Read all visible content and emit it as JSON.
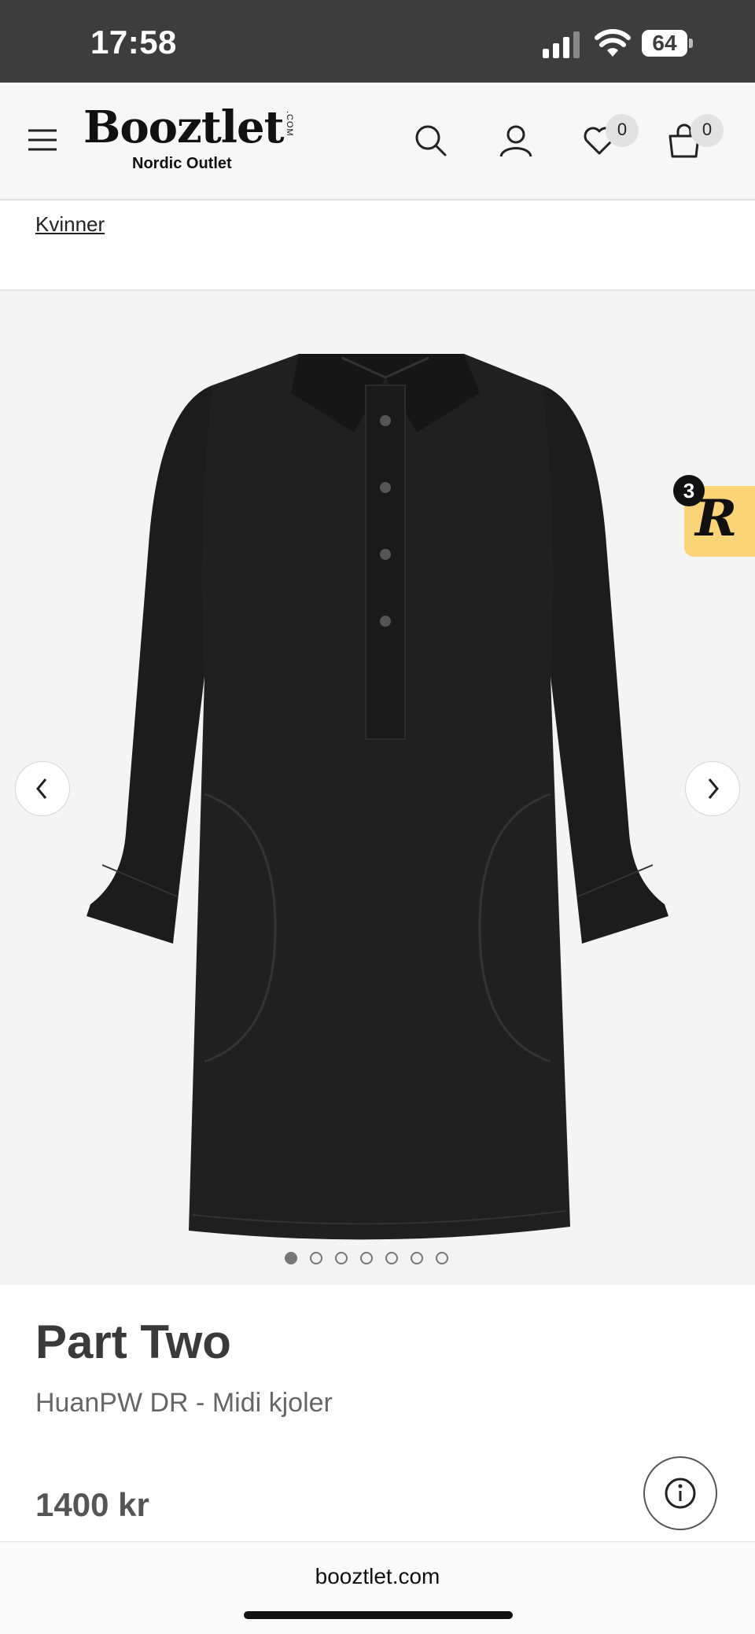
{
  "status_bar": {
    "time": "17:58",
    "battery": "64",
    "icons": [
      "signal-icon",
      "wifi-icon",
      "battery-icon"
    ]
  },
  "header": {
    "logo": "Booztlet",
    "logo_com": ".COM",
    "logo_sub": "Nordic Outlet",
    "wishlist_count": "0",
    "cart_count": "0",
    "icons": [
      "menu-icon",
      "search-icon",
      "account-icon",
      "heart-icon",
      "bag-icon"
    ]
  },
  "breadcrumb": {
    "label": "Kvinner"
  },
  "gallery": {
    "image_count": 7,
    "active_index": 0,
    "reviews_count": "3",
    "reviews_logo": "R",
    "icons": [
      "chevron-left-icon",
      "chevron-right-icon"
    ]
  },
  "product": {
    "brand": "Part Two",
    "name": "HuanPW DR - Midi kjoler",
    "price": "1400 kr"
  },
  "browser": {
    "url": "booztlet.com"
  },
  "colors": {
    "status_bar": "#3d3d3d",
    "header_bg": "#f7f7f7",
    "gallery_bg": "#f4f4f4",
    "reviews_yellow": "#fcd478",
    "dress": "#1e1e1e"
  }
}
